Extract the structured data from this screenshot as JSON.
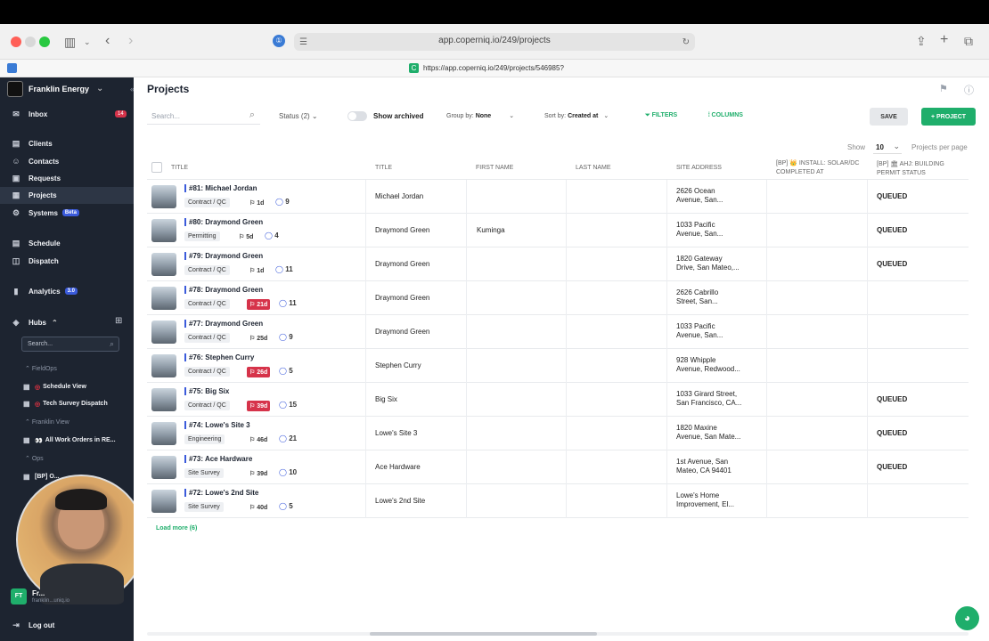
{
  "browser": {
    "url": "app.coperniq.io/249/projects",
    "sub_url": "https://app.coperniq.io/249/projects/546985?"
  },
  "sidebar": {
    "company": "Franklin Energy",
    "inbox": {
      "label": "Inbox",
      "count": "14"
    },
    "items": [
      {
        "label": "Clients",
        "icon": "clients-icon"
      },
      {
        "label": "Contacts",
        "icon": "contacts-icon"
      },
      {
        "label": "Requests",
        "icon": "requests-icon"
      },
      {
        "label": "Projects",
        "icon": "projects-icon"
      },
      {
        "label": "Systems",
        "icon": "systems-icon",
        "badge": "Beta"
      }
    ],
    "items2": [
      {
        "label": "Schedule",
        "icon": "schedule-icon"
      },
      {
        "label": "Dispatch",
        "icon": "dispatch-icon"
      }
    ],
    "analytics": {
      "label": "Analytics",
      "badge": "3.0"
    },
    "hubs_label": "Hubs",
    "search_placeholder": "Search...",
    "groups": [
      {
        "label": "FieldOps"
      },
      {
        "hub": "Schedule View"
      },
      {
        "hub": "Tech Survey Dispatch"
      },
      {
        "label": "Franklin View"
      },
      {
        "hub": "All Work Orders in RE..."
      },
      {
        "label": "Ops"
      },
      {
        "hub": "[BP] O..."
      }
    ],
    "user_initials": "FT",
    "user_name": "Fr...",
    "user_email": "franklin...uniq.io",
    "logout": "Log out"
  },
  "main": {
    "title": "Projects",
    "search_placeholder": "Search...",
    "status_filter": "Status (2)",
    "show_archived": "Show archived",
    "group_by_label": "Group by:",
    "group_by_value": "None",
    "sort_by_label": "Sort by:",
    "sort_by_value": "Created at",
    "filters": "FILTERS",
    "columns": "COLUMNS",
    "save": "SAVE",
    "new_project": "+ PROJECT",
    "show_label": "Show",
    "per_page": "10",
    "per_page_suffix": "Projects per page",
    "headers": {
      "title": "TITLE",
      "title2": "TITLE",
      "first_name": "FIRST NAME",
      "last_name": "LAST NAME",
      "site_address": "SITE ADDRESS",
      "install": "[BP] 👑 INSTALL: SOLAR/DC COMPLETED AT",
      "ahj": "[BP] 🏛 AHJ: BUILDING PERMIT STATUS"
    },
    "rows": [
      {
        "name": "#81: Michael Jordan",
        "stage": "Contract / QC",
        "days": "1d",
        "red": false,
        "tasks": "9",
        "title": "Michael Jordan",
        "first": "",
        "addr1": "2626 Ocean",
        "addr2": "Avenue, San...",
        "status": "QUEUED"
      },
      {
        "name": "#80: Draymond Green",
        "stage": "Permitting",
        "days": "5d",
        "red": false,
        "tasks": "4",
        "title": "Draymond Green",
        "first": "Kuminga",
        "addr1": "1033 Pacific",
        "addr2": "Avenue, San...",
        "status": "QUEUED"
      },
      {
        "name": "#79: Draymond Green",
        "stage": "Contract / QC",
        "days": "1d",
        "red": false,
        "tasks": "11",
        "title": "Draymond Green",
        "first": "",
        "addr1": "1820 Gateway",
        "addr2": "Drive, San Mateo,...",
        "status": "QUEUED"
      },
      {
        "name": "#78: Draymond Green",
        "stage": "Contract / QC",
        "days": "21d",
        "red": true,
        "tasks": "11",
        "title": "Draymond Green",
        "first": "",
        "addr1": "2626 Cabrillo",
        "addr2": "Street, San...",
        "status": ""
      },
      {
        "name": "#77: Draymond Green",
        "stage": "Contract / QC",
        "days": "25d",
        "red": false,
        "tasks": "9",
        "title": "Draymond Green",
        "first": "",
        "addr1": "1033 Pacific",
        "addr2": "Avenue, San...",
        "status": ""
      },
      {
        "name": "#76: Stephen Curry",
        "stage": "Contract / QC",
        "days": "26d",
        "red": true,
        "tasks": "5",
        "title": "Stephen Curry",
        "first": "",
        "addr1": "928 Whipple",
        "addr2": "Avenue, Redwood...",
        "status": ""
      },
      {
        "name": "#75: Big Six",
        "stage": "Contract / QC",
        "days": "39d",
        "red": true,
        "tasks": "15",
        "title": "Big Six",
        "first": "",
        "addr1": "1033 Girard Street,",
        "addr2": "San Francisco, CA...",
        "status": "QUEUED"
      },
      {
        "name": "#74: Lowe's Site 3",
        "stage": "Engineering",
        "days": "46d",
        "red": false,
        "tasks": "21",
        "title": "Lowe's Site 3",
        "first": "",
        "addr1": "1820 Maxine",
        "addr2": "Avenue, San Mate...",
        "status": "QUEUED"
      },
      {
        "name": "#73: Ace Hardware",
        "stage": "Site Survey",
        "days": "39d",
        "red": false,
        "tasks": "10",
        "title": "Ace Hardware",
        "first": "",
        "addr1": "1st Avenue, San",
        "addr2": "Mateo, CA 94401",
        "status": "QUEUED"
      },
      {
        "name": "#72: Lowe's 2nd Site",
        "stage": "Site Survey",
        "days": "40d",
        "red": false,
        "tasks": "5",
        "title": "Lowe's 2nd Site",
        "first": "",
        "addr1": "Lowe's Home",
        "addr2": "Improvement, El...",
        "status": ""
      }
    ],
    "load_more": "Load more (6)"
  },
  "colors": {
    "sidebar": "#1d2430",
    "accent_green": "#1fae6b",
    "red_badge": "#d6334a",
    "link_blue": "#3b5bdb"
  }
}
